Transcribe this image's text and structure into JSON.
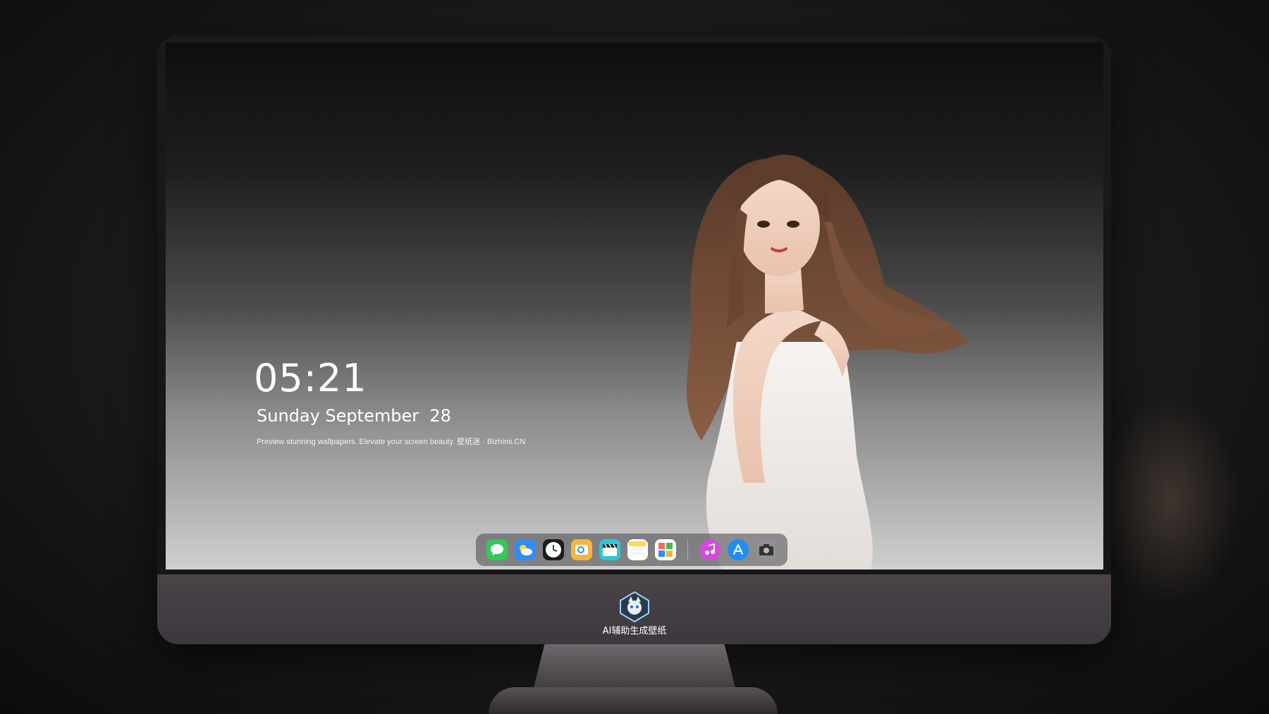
{
  "lockscreen": {
    "time": "05:21",
    "date": "Sunday September  28",
    "tagline": "Preview stunning wallpapers. Elevate your screen beauty. 壁纸迷 · Bizhimi.CN"
  },
  "dock": {
    "apps": [
      {
        "icon": "messages-icon",
        "color": "#34c759"
      },
      {
        "icon": "weather-icon",
        "color": "#2f8df6"
      },
      {
        "icon": "clock-icon",
        "color": "#1c1c1e"
      },
      {
        "icon": "preview-icon",
        "color": "#f4b63f"
      },
      {
        "icon": "clapper-icon",
        "color": "#2ec7d8"
      },
      {
        "icon": "notes-icon",
        "color": "#ffd84d"
      },
      {
        "icon": "photos-icon",
        "color": "#ffffff"
      },
      {
        "icon": "music-icon",
        "color": "#d54bd9"
      },
      {
        "icon": "app-store-icon",
        "color": "#1e8ef4"
      },
      {
        "icon": "camera-icon",
        "color": "#8e8e93"
      }
    ]
  },
  "brand": {
    "label": "AI辅助生成壁纸"
  }
}
